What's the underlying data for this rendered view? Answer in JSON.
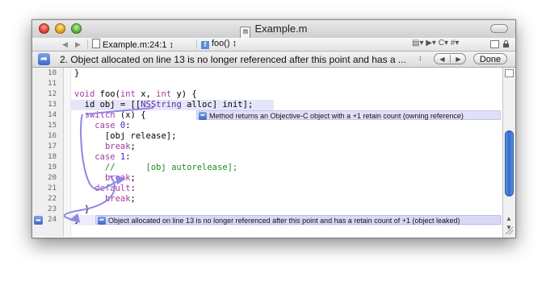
{
  "window": {
    "title": "Example.m",
    "file_icon_letter": "m"
  },
  "nav": {
    "file_crumb": "Example.m:24:1 ↕",
    "func_crumb": "foo() ↕",
    "func_badge": "f",
    "right_items": "▤▾  ▶▾  C▾  #▾"
  },
  "message": {
    "text": "2. Object allocated on line 13 is no longer referenced after this point and has a ...",
    "stepper": "↕",
    "prev_label": "◀",
    "next_label": "▶",
    "done_label": "Done"
  },
  "editor": {
    "line_numbers": [
      "10",
      "11",
      "12",
      "13",
      "14",
      "15",
      "16",
      "17",
      "18",
      "19",
      "20",
      "21",
      "22",
      "23",
      "24"
    ],
    "bubble_method": "Method returns an Objective-C object with a +1 retain count (owning reference)",
    "bubble_leak": "Object allocated on line 13 is no longer referenced after this point and has a retain count of +1 (object leaked)"
  },
  "colors": {
    "keyword": "#a33b9e",
    "number": "#2f2fd0",
    "comment": "#1f8a1f",
    "bubble_bg": "#dcdcf6",
    "highlight_line": "#e9e9fb",
    "arrow": "#8f86e6"
  },
  "icons": [
    "file-m-icon",
    "back-arrow-icon",
    "forward-arrow-icon",
    "analyzer-icon",
    "split-editor-icon",
    "lock-icon",
    "bubble-arrow-icon",
    "resize-grip-icon"
  ]
}
